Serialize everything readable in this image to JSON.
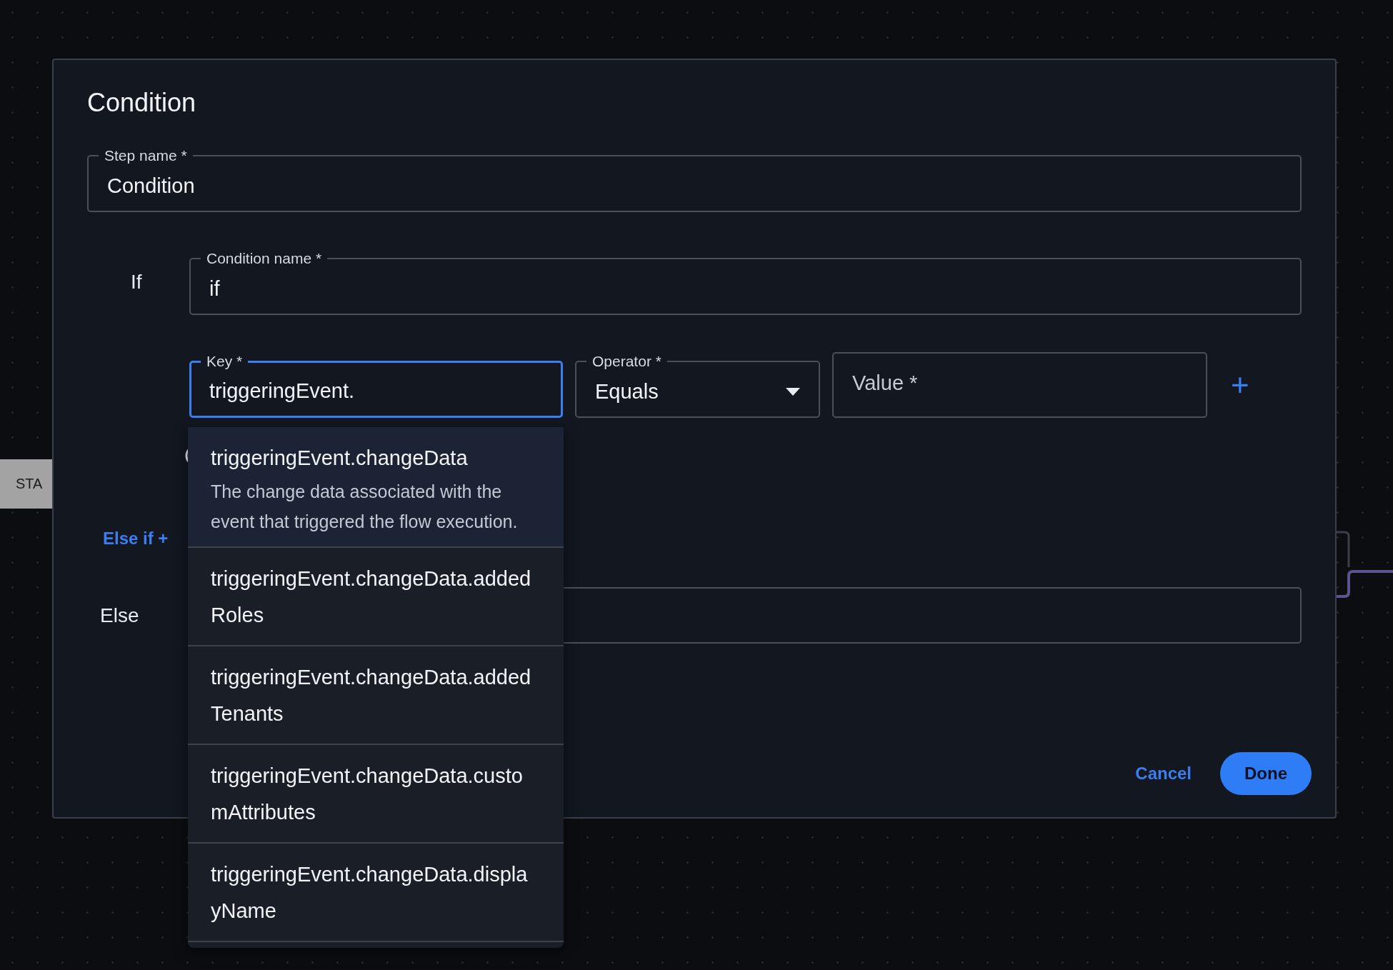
{
  "canvas": {
    "node": "STA"
  },
  "dialog": {
    "title": "Condition"
  },
  "step_name": {
    "label": "Step name *",
    "value": "Condition"
  },
  "if_block": {
    "label": "If",
    "condition_name": {
      "label": "Condition name *",
      "value": "if"
    },
    "key": {
      "label": "Key *",
      "value": "triggeringEvent.",
      "focused": true
    },
    "operator": {
      "label": "Operator *",
      "value": "Equals"
    },
    "value": {
      "placeholder": "Value *"
    },
    "add": "+"
  },
  "else_if": "Else if +",
  "else_block": {
    "label": "Else"
  },
  "buttons": {
    "cancel": "Cancel",
    "done": "Done"
  },
  "suggestions": [
    {
      "label": "triggeringEvent.changeData",
      "description": "The change data associated with the event that triggered the flow execution.",
      "selected": true
    },
    {
      "label": "triggeringEvent.changeData.addedRoles",
      "selected": false
    },
    {
      "label": "triggeringEvent.changeData.addedTenants",
      "selected": false
    },
    {
      "label": "triggeringEvent.changeData.customAttributes",
      "selected": false
    },
    {
      "label": "triggeringEvent.changeData.displayName",
      "selected": false
    }
  ]
}
